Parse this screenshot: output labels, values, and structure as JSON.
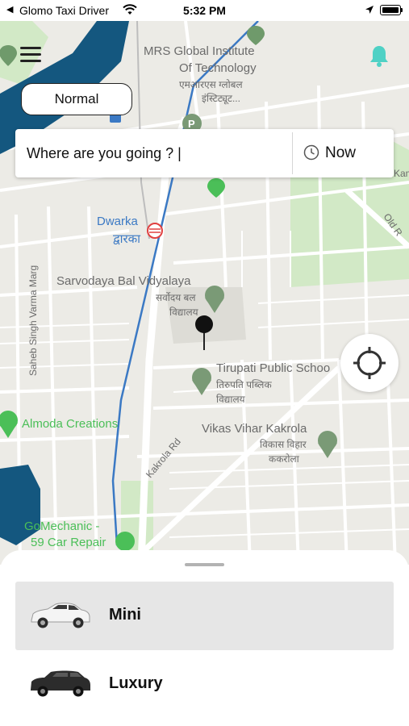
{
  "status_bar": {
    "back_indicator": "◀",
    "app_name": "Glomo Taxi Driver",
    "time": "5:32 PM"
  },
  "map": {
    "labels": {
      "mrs_line1": "MRS Global Institute",
      "mrs_line2": "Of Technology",
      "mrs_hindi1": "एमआरएस ग्लोबल",
      "mrs_hindi2": "इंस्टिट्यूट...",
      "dwarka": "Dwarka",
      "dwarka_hindi": "द्वारका",
      "sarvodaya": "Sarvodaya Bal Vidyalaya",
      "sarvodaya_hindi1": "सर्वोदय बल",
      "sarvodaya_hindi2": "विद्यालय",
      "tirupati": "Tirupati Public Schoo",
      "tirupati_hindi1": "तिरुपति पब्लिक",
      "tirupati_hindi2": "विद्यालय",
      "vikas": "Vikas Vihar Kakrola",
      "vikas_hindi1": "विकास विहार",
      "vikas_hindi2": "ककरोला",
      "almoda": "Almoda Creations",
      "gomechanic1": "GoMechanic -",
      "gomechanic2": "59 Car Repair",
      "kakrola_rd": "Kakrola Rd",
      "saheb_marg": "Saheb Singh Varma Marg",
      "old_road": "Old R",
      "kamla": "Kamla Pa"
    }
  },
  "header": {
    "mode_button": "Normal"
  },
  "search": {
    "placeholder": "Where are you going ? |",
    "time_label": "Now"
  },
  "rides": [
    {
      "name": "Mini",
      "selected": true
    },
    {
      "name": "Luxury",
      "selected": false
    }
  ],
  "colors": {
    "map_background": "#ecebe6",
    "water": "#14577f",
    "park": "#d2e9c6",
    "route": "#3b79c4",
    "bell_accent": "#4fd1c5",
    "selected_ride": "#e6e6e6"
  },
  "icons": [
    "menu-icon",
    "bell-icon",
    "clock-icon",
    "crosshair-icon",
    "wifi-icon",
    "location-arrow-icon",
    "battery-icon",
    "car-icon"
  ]
}
